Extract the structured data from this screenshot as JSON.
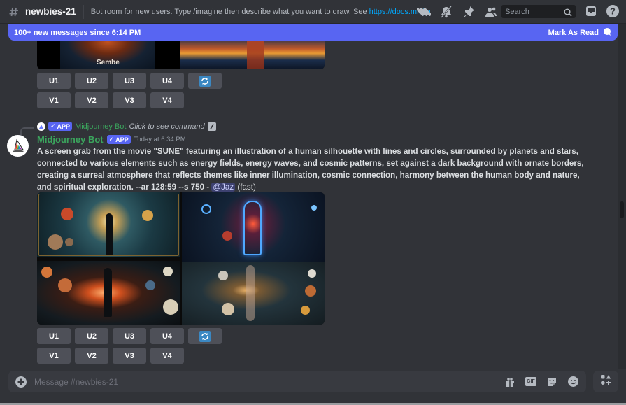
{
  "header": {
    "channel_icon": "hash-thread-icon",
    "channel_name": "newbies-21",
    "topic_text": "Bot room for new users. Type /imagine then describe what you want to draw. See ",
    "topic_link": "https://docs.midjourn...",
    "icons": [
      "threads-icon",
      "muted-bell-icon",
      "pin-icon",
      "members-icon"
    ],
    "search_placeholder": "Search",
    "inbox_icon": "inbox-icon",
    "help_icon": "help-icon"
  },
  "new_messages_bar": {
    "text": "100+ new messages since 6:14 PM",
    "mark_read": "Mark As Read"
  },
  "previous_message": {
    "image_caption_left": "Sembe",
    "buttons_row1": [
      "U1",
      "U2",
      "U3",
      "U4"
    ],
    "buttons_row2": [
      "V1",
      "V2",
      "V3",
      "V4"
    ],
    "reroll_icon": "reroll-icon"
  },
  "message": {
    "reply": {
      "bot_name": "Midjourney Bot",
      "badge": "APP",
      "hint": "Click to see command"
    },
    "author": "Midjourney Bot",
    "badge": "APP",
    "timestamp": "Today at 6:34 PM",
    "prompt": "A screen grab from the movie \"SUNE\" featuring an illustration of a human silhouette with lines and circles, surrounded by planets and stars, connected to various elements such as energy fields, energy waves, and cosmic patterns, set against a dark background with ornate borders, creating a surreal atmosphere that reflects themes like inner illumination, cosmic connection, harmony between the human body and nature, and spiritual exploration. --ar 128:59 --s 750",
    "separator": " - ",
    "mention": "@Jaz",
    "speed": "(fast)",
    "buttons_row1": [
      "U1",
      "U2",
      "U3",
      "U4"
    ],
    "buttons_row2": [
      "V1",
      "V2",
      "V3",
      "V4"
    ],
    "reroll_icon": "reroll-icon"
  },
  "composer": {
    "placeholder": "Message #newbies-21",
    "icons": [
      "gift-icon",
      "gif-icon",
      "sticker-icon",
      "emoji-icon"
    ],
    "gif_label": "GIF",
    "apps_icon": "apps-icon"
  },
  "colors": {
    "background": "#313338",
    "accent": "#5865f2",
    "bot_name": "#3ba55d",
    "link": "#00a8fc",
    "button": "#4e5058",
    "reroll": "#3b88c3"
  }
}
